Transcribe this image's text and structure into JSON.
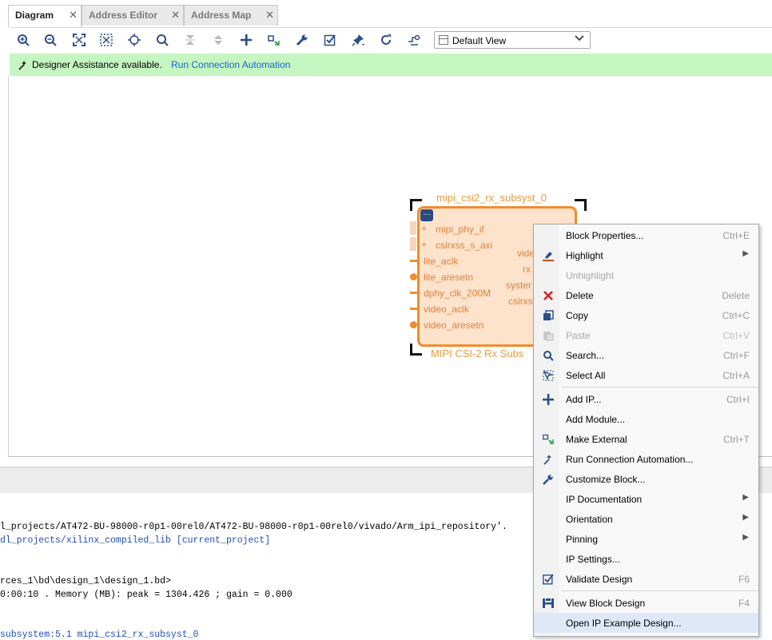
{
  "tabs": [
    {
      "label": "Diagram",
      "active": true
    },
    {
      "label": "Address Editor",
      "active": false
    },
    {
      "label": "Address Map",
      "active": false
    }
  ],
  "toolbar": {
    "icons": [
      "zoom-in-icon",
      "zoom-out-icon",
      "fit-view-icon",
      "fit-selection-icon",
      "auto-connect-icon",
      "search-icon",
      "collapse-all-icon",
      "expand-all-icon",
      "add-ip-icon",
      "make-external-icon",
      "customize-wrench-icon",
      "validate-icon",
      "pin-icon",
      "regenerate-layout-icon",
      "optimize-routing-icon"
    ],
    "view_select": "Default View"
  },
  "banner": {
    "text": "Designer Assistance available.",
    "link": "Run Connection Automation",
    "bg_color": "#c5f5c0"
  },
  "block": {
    "instance_name": "mipi_csi2_rx_subsyst_0",
    "subtitle": "MIPI CSI-2 Rx Subs",
    "left_pins": [
      "mipi_phy_if",
      "csirxss_s_axi",
      "lite_aclk",
      "lite_aresetn",
      "dphy_clk_200M",
      "video_aclk",
      "video_aresetn"
    ],
    "right_pins": [
      "vide",
      "rx",
      "syster",
      "csirxs"
    ],
    "accent_color": "#f28c2a",
    "fill_color": "#fde3cc"
  },
  "context_menu": {
    "items": [
      {
        "label": "Block Properties...",
        "shortcut": "Ctrl+E",
        "icon": ""
      },
      {
        "label": "Highlight",
        "submenu": true,
        "icon": "highlight-brush-icon"
      },
      {
        "label": "Unhighlight",
        "disabled": true,
        "icon": ""
      },
      {
        "label": "Delete",
        "shortcut": "Delete",
        "icon": "delete-x-icon"
      },
      {
        "label": "Copy",
        "shortcut": "Ctrl+C",
        "icon": "copy-icon"
      },
      {
        "label": "Paste",
        "shortcut": "Ctrl+V",
        "disabled": true,
        "icon": "paste-icon"
      },
      {
        "label": "Search...",
        "shortcut": "Ctrl+F",
        "icon": "search-icon"
      },
      {
        "label": "Select All",
        "shortcut": "Ctrl+A",
        "icon": "select-all-icon"
      },
      {
        "label": "Add IP...",
        "shortcut": "Ctrl+I",
        "icon": "add-ip-icon"
      },
      {
        "label": "Add Module...",
        "icon": ""
      },
      {
        "label": "Make External",
        "shortcut": "Ctrl+T",
        "icon": "make-external-icon"
      },
      {
        "label": "Run Connection Automation...",
        "icon": "connection-automation-icon"
      },
      {
        "label": "Customize Block...",
        "icon": "customize-wrench-icon"
      },
      {
        "label": "IP Documentation",
        "submenu": true,
        "icon": ""
      },
      {
        "label": "Orientation",
        "submenu": true,
        "icon": ""
      },
      {
        "label": "Pinning",
        "submenu": true,
        "icon": ""
      },
      {
        "label": "IP Settings...",
        "icon": ""
      },
      {
        "label": "Validate Design",
        "shortcut": "F6",
        "icon": "validate-icon"
      },
      {
        "label": "View Block Design",
        "shortcut": "F4",
        "icon": "view-block-design-icon"
      },
      {
        "label": "Open IP Example Design...",
        "highlighted": true,
        "icon": ""
      }
    ]
  },
  "console": {
    "lines": [
      {
        "text": "l_projects/AT472-BU-98000-r0p1-00rel0/AT472-BU-98000-r0p1-00rel0/vivado/Arm_ipi_repository'.",
        "color": "black"
      },
      {
        "text": "dl_projects/xilinx_compiled_lib [current_project]",
        "color": "blue"
      },
      {
        "text": "rces_1\\bd\\design_1\\design_1.bd>",
        "color": "black"
      },
      {
        "text": "0:00:10 . Memory (MB): peak = 1304.426 ; gain = 0.000",
        "color": "black"
      },
      {
        "text": "subsystem:5.1 mipi_csi2_rx_subsyst_0",
        "color": "blue"
      }
    ]
  }
}
